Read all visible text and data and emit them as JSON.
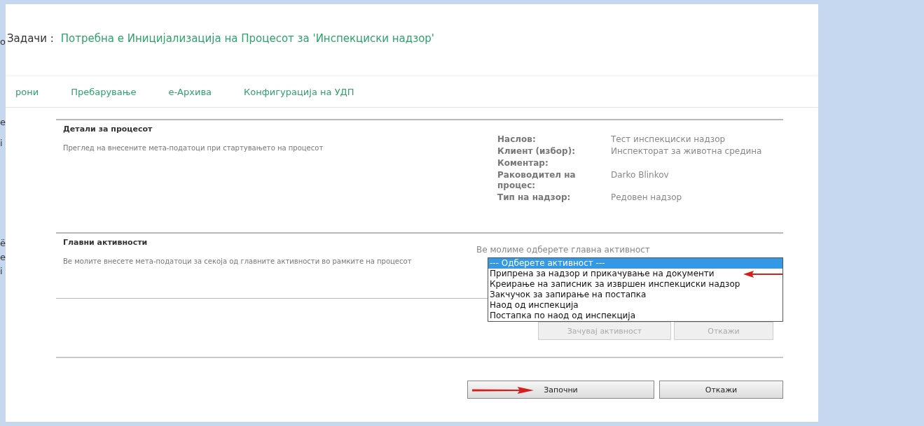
{
  "edge_fragments": [
    "о",
    "е",
    "i",
    "ë",
    "е",
    "i"
  ],
  "header": {
    "label": "Задачи :",
    "title": "Потребна е Иницијализација на Процесот за 'Инспекциски надзор'"
  },
  "nav": [
    {
      "label": "рони"
    },
    {
      "label": "Пребарување"
    },
    {
      "label": "е-Архива"
    },
    {
      "label": "Конфигурација на УДП"
    }
  ],
  "details": {
    "title": "Детали за процесот",
    "description": "Преглед на внесените мета-податоци при стартувањето на процесот",
    "fields": [
      {
        "label": "Наслов:",
        "value": "Тест инспекциски надзор"
      },
      {
        "label": "Клиент (избор):",
        "value": "Инспекторат за животна средина"
      },
      {
        "label": "Коментар:"
      },
      {
        "label": "Раководител на процес:",
        "value": "Darko Blinkov"
      },
      {
        "label": "Тип на надзор:",
        "value": "Редовен надзор"
      }
    ]
  },
  "activities": {
    "title": "Главни активности",
    "description": "Ве молите внесете мета-податоци за секоја од главните активности во рамките на процесот",
    "prompt": "Ве молиме одберете главна активност",
    "options": [
      {
        "label": "--- Одберете активност ---",
        "selected": true,
        "pointer": false
      },
      {
        "label": "Припрена за надзор и прикачување на документи",
        "selected": false,
        "pointer": true
      },
      {
        "label": "Креирање на записник за извршен инспекциски надзор",
        "selected": false,
        "pointer": false
      },
      {
        "label": "Закчучок за запирање на постапка",
        "selected": false,
        "pointer": false
      },
      {
        "label": "Наод од инспекција",
        "selected": false,
        "pointer": false
      },
      {
        "label": "Постапка по наод од инспекција",
        "selected": false,
        "pointer": false
      }
    ],
    "buttons": [
      {
        "label": "Зачувај активност",
        "disabled": true
      },
      {
        "label": "Откажи",
        "disabled": true
      }
    ]
  },
  "footer_buttons": [
    {
      "label": "Започни",
      "pointer": true
    },
    {
      "label": "Откажи",
      "pointer": false
    }
  ]
}
